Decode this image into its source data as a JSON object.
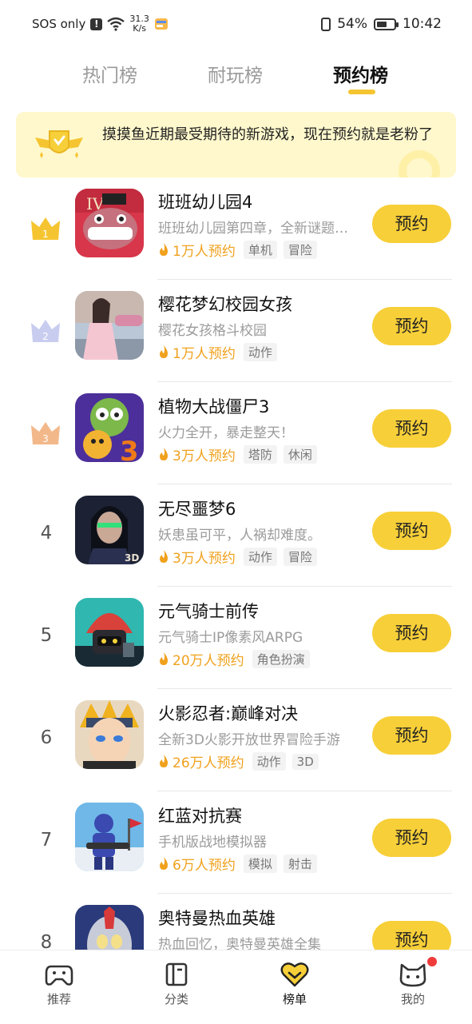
{
  "status": {
    "carrier": "SOS only",
    "speed_value": "31.3",
    "speed_unit": "K/s",
    "battery": "54%",
    "time": "10:42"
  },
  "tabs": [
    {
      "label": "热门榜"
    },
    {
      "label": "耐玩榜"
    },
    {
      "label": "预约榜"
    }
  ],
  "active_tab": "预约榜",
  "banner": {
    "text": "摸摸鱼近期最受期待的新游戏，现在预约就是老粉了"
  },
  "games": [
    {
      "rank": "1",
      "name": "班班幼儿园4",
      "desc": "班班幼儿园第四章，全新谜题等你挑战",
      "count": "1万人预约",
      "tags": [
        "单机",
        "冒险"
      ],
      "button": "预约"
    },
    {
      "rank": "2",
      "name": "樱花梦幻校园女孩",
      "desc": "樱花女孩格斗校园",
      "count": "1万人预约",
      "tags": [
        "动作"
      ],
      "button": "预约"
    },
    {
      "rank": "3",
      "name": "植物大战僵尸3",
      "desc": "火力全开，暴走整天！",
      "count": "3万人预约",
      "tags": [
        "塔防",
        "休闲"
      ],
      "button": "预约"
    },
    {
      "rank": "4",
      "name": "无尽噩梦6",
      "desc": "妖患虽可平，人祸却难度。",
      "count": "3万人预约",
      "tags": [
        "动作",
        "冒险"
      ],
      "button": "预约"
    },
    {
      "rank": "5",
      "name": "元气骑士前传",
      "desc": "元气骑士IP像素风ARPG",
      "count": "20万人预约",
      "tags": [
        "角色扮演"
      ],
      "button": "预约"
    },
    {
      "rank": "6",
      "name": "火影忍者:巅峰对决",
      "desc": "全新3D火影开放世界冒险手游",
      "count": "26万人预约",
      "tags": [
        "动作",
        "3D"
      ],
      "button": "预约"
    },
    {
      "rank": "7",
      "name": "红蓝对抗赛",
      "desc": "手机版战地模拟器",
      "count": "6万人预约",
      "tags": [
        "模拟",
        "射击"
      ],
      "button": "预约"
    },
    {
      "rank": "8",
      "name": "奥特曼热血英雄",
      "desc": "热血回忆，奥特曼英雄全集",
      "count": "",
      "tags": [],
      "button": "预约"
    }
  ],
  "nav": [
    {
      "label": "推荐",
      "icon": "gamepad-icon"
    },
    {
      "label": "分类",
      "icon": "book-icon"
    },
    {
      "label": "榜单",
      "icon": "heart-chevron-icon"
    },
    {
      "label": "我的",
      "icon": "cat-face-icon"
    }
  ],
  "colors": {
    "accent": "#f7cf38",
    "count_text": "#f0a11d",
    "banner_bg": "#fff8cc",
    "gold": "#f5c531",
    "silver": "#b8c0e8",
    "bronze": "#f0b080"
  }
}
